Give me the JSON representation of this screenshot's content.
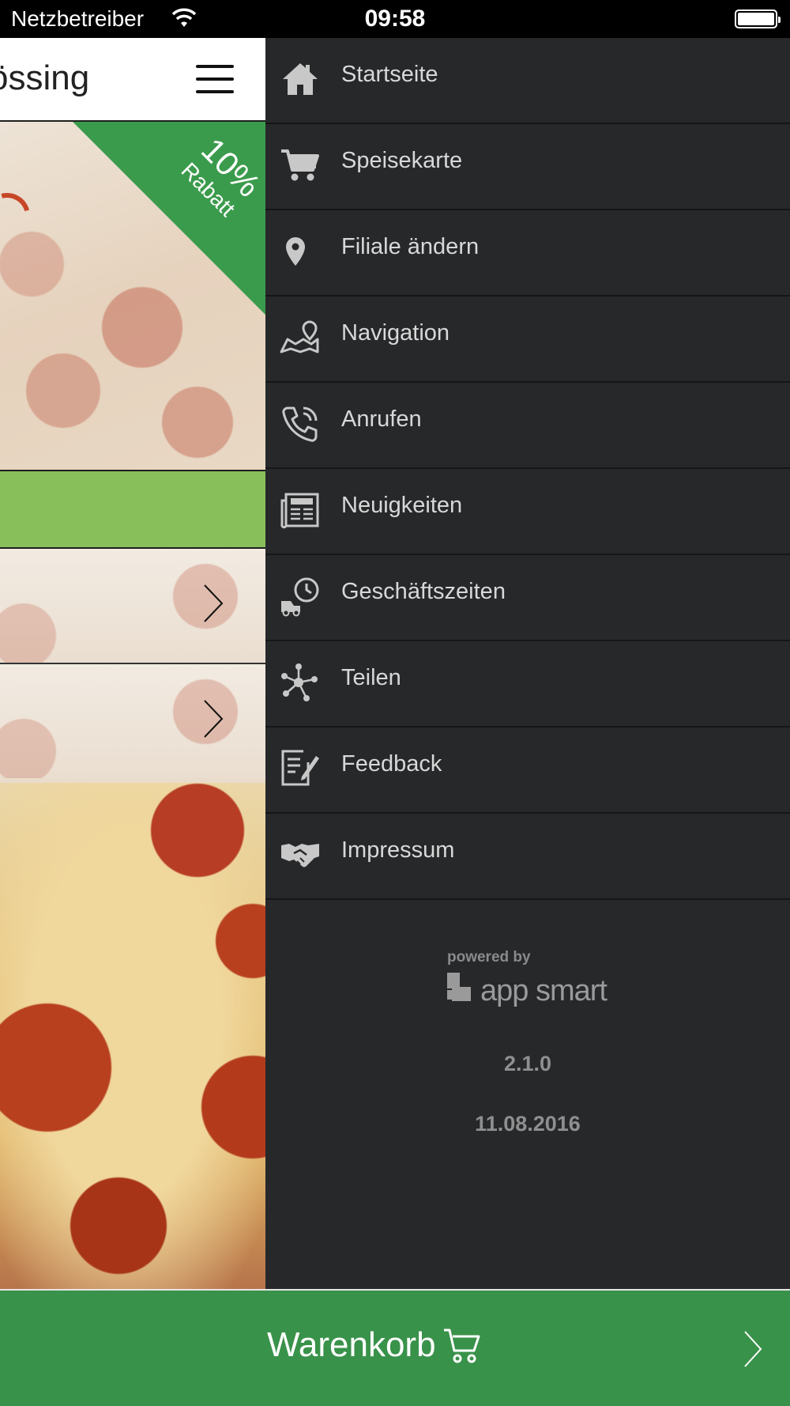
{
  "status_bar": {
    "carrier": "Netzbetreiber",
    "time": "09:58",
    "wifi_icon": "wifi-icon",
    "battery_icon": "battery-icon"
  },
  "app": {
    "title_fragment": "össing",
    "promo": {
      "percent": "10%",
      "label": "Rabatt",
      "color": "#3b9b4c"
    },
    "accent_green": "#88bf5b"
  },
  "menu": {
    "background": "#26282a",
    "items": [
      {
        "label": "Startseite",
        "icon": "home-icon"
      },
      {
        "label": "Speisekarte",
        "icon": "cart-icon"
      },
      {
        "label": "Filiale ändern",
        "icon": "location-pin-icon"
      },
      {
        "label": "Navigation",
        "icon": "map-icon"
      },
      {
        "label": "Anrufen",
        "icon": "phone-icon"
      },
      {
        "label": "Neuigkeiten",
        "icon": "news-icon"
      },
      {
        "label": "Geschäftszeiten",
        "icon": "delivery-clock-icon"
      },
      {
        "label": "Teilen",
        "icon": "share-icon"
      },
      {
        "label": "Feedback",
        "icon": "feedback-icon"
      },
      {
        "label": "Impressum",
        "icon": "handshake-icon"
      }
    ],
    "footer": {
      "powered_by": "powered by",
      "brand": "app smart",
      "version": "2.1.0",
      "date": "11.08.2016"
    }
  },
  "cart": {
    "label": "Warenkorb",
    "icon": "cart-icon",
    "color": "#39924a"
  }
}
